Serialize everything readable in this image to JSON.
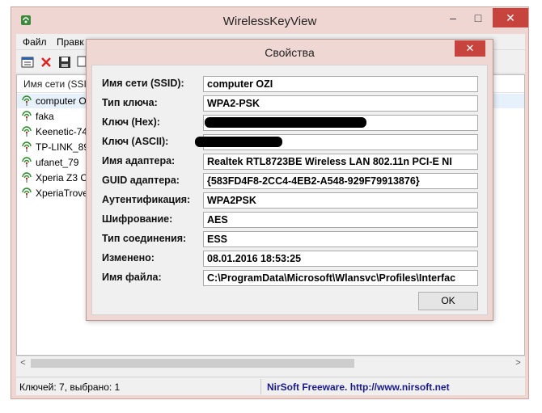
{
  "main_window": {
    "title": "WirelessKeyView",
    "controls": {
      "minimize": "–",
      "maximize": "□",
      "close": "✕"
    },
    "menu": [
      "Файл",
      "Правк"
    ],
    "list_header": "Имя сети (SSID",
    "networks": [
      "computer O",
      "faka",
      "Keenetic-74",
      "TP-LINK_89",
      "ufanet_79",
      "Xperia Z3 Co",
      "XperiaTrove"
    ],
    "selected_index": 0,
    "status_left": "Ключей: 7, выбрано: 1",
    "status_right": "NirSoft Freeware.  http://www.nirsoft.net",
    "scroll_left": "<",
    "scroll_right": ">"
  },
  "dialog": {
    "title": "Свойства",
    "close": "✕",
    "properties": [
      {
        "label": "Имя сети (SSID):",
        "value": "computer OZI"
      },
      {
        "label": "Тип ключа:",
        "value": "WPA2-PSK"
      },
      {
        "label": "Ключ (Hex):",
        "value": ""
      },
      {
        "label": "Ключ (ASCII):",
        "value": ""
      },
      {
        "label": "Имя адаптера:",
        "value": "Realtek RTL8723BE Wireless LAN 802.11n PCI-E NI"
      },
      {
        "label": "GUID адаптера:",
        "value": "{583FD4F8-2CC4-4EB2-A548-929F79913876}"
      },
      {
        "label": "Аутентификация:",
        "value": "WPA2PSK"
      },
      {
        "label": "Шифрование:",
        "value": "AES"
      },
      {
        "label": "Тип соединения:",
        "value": "ESS"
      },
      {
        "label": "Изменено:",
        "value": "08.01.2016 18:53:25"
      },
      {
        "label": "Имя файла:",
        "value": "C:\\ProgramData\\Microsoft\\Wlansvc\\Profiles\\Interfac"
      }
    ],
    "ok_label": "OK"
  },
  "icons": [
    "wifi-icon",
    "properties-icon",
    "delete-icon",
    "save-icon",
    "copy-icon"
  ],
  "colors": {
    "accent_close": "#c7443e",
    "window_frame": "#f0d6d2",
    "selection": "#e7f1fb",
    "link_text": "#1a1a8a"
  }
}
